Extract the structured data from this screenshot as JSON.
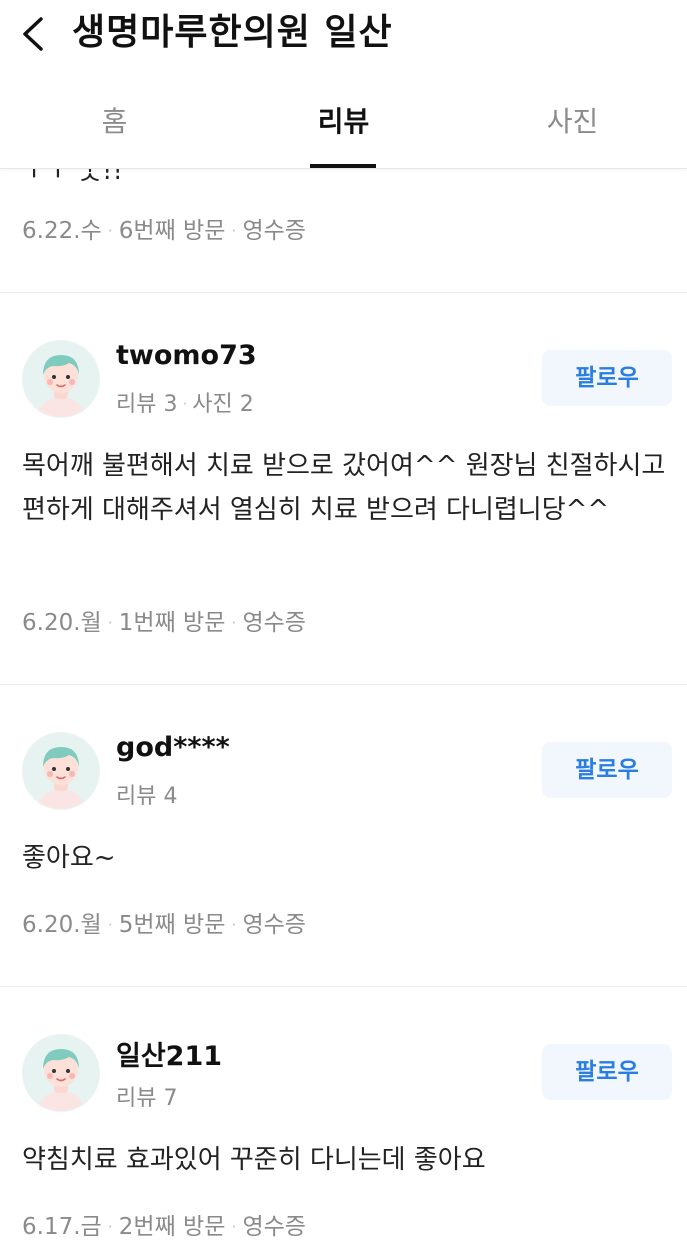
{
  "header": {
    "title": "생명마루한의원 일산"
  },
  "tabs": [
    {
      "label": "홈"
    },
    {
      "label": "리뷰"
    },
    {
      "label": "사진"
    }
  ],
  "first_partial": {
    "text_fragment": "ㅜㅜ 굿!!",
    "date": "6.22.수",
    "visit": "6번째 방문",
    "receipt": "영수증"
  },
  "reviews": [
    {
      "nickname": "twomo73",
      "review_count": "리뷰 3",
      "photo_count": "사진 2",
      "follow_label": "팔로우",
      "text": "목어깨 불편해서 치료 받으로 갔어여^^ 원장님 친절하시고 편하게 대해주셔서 열심히 치료 받으려 다니렵니당^^",
      "date": "6.20.월",
      "visit": "1번째 방문",
      "receipt": "영수증"
    },
    {
      "nickname": "god****",
      "review_count": "리뷰 4",
      "follow_label": "팔로우",
      "text": "좋아요~",
      "date": "6.20.월",
      "visit": "5번째 방문",
      "receipt": "영수증"
    },
    {
      "nickname": "일산211",
      "review_count": "리뷰 7",
      "follow_label": "팔로우",
      "text": "약침치료 효과있어 꾸준히 다니는데 좋아요",
      "date": "6.17.금",
      "visit": "2번째 방문",
      "receipt": "영수증"
    }
  ],
  "colors": {
    "accent_blue": "#2a7de1",
    "follow_bg": "#f2f7fd",
    "meta_gray": "#8a8a8a",
    "divider": "#ebebeb"
  },
  "icons": {
    "back": "chevron-left-icon",
    "avatar": "default-avatar-icon"
  }
}
